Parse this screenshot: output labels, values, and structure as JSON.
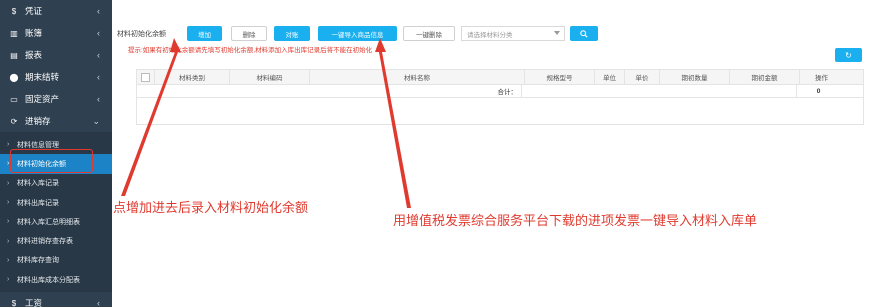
{
  "sidebar": {
    "items": [
      {
        "label": "凭证",
        "icon": "$"
      },
      {
        "label": "账簿",
        "icon": "▥"
      },
      {
        "label": "报表",
        "icon": "▤"
      },
      {
        "label": "期末结转",
        "icon": "⬤"
      },
      {
        "label": "固定资产",
        "icon": "▭"
      },
      {
        "label": "进销存",
        "icon": "⟳"
      }
    ],
    "sub_items": [
      {
        "label": "材料信息管理"
      },
      {
        "label": "材料初始化余额"
      },
      {
        "label": "材料入库记录"
      },
      {
        "label": "材料出库记录"
      },
      {
        "label": "材料入库汇总明细表"
      },
      {
        "label": "材料进销存查存表"
      },
      {
        "label": "材料库存查询"
      },
      {
        "label": "材料出库成本分配表"
      }
    ],
    "bottom_item": {
      "label": "工资",
      "icon": "$"
    }
  },
  "toolbar": {
    "title": "材料初始化余额",
    "add": "增加",
    "delete": "删除",
    "reconcile": "对账",
    "import": "一键导入商品信息",
    "delete_all": "一键删除",
    "category_placeholder": "请选择材料分类"
  },
  "hint": "提示:如果有初始化余额请先填写初始化余额,材料添加入库出库记录后将不能在初始化",
  "table": {
    "headers": [
      "材料类别",
      "材料编码",
      "材料名称",
      "规格型号",
      "单位",
      "单价",
      "期初数量",
      "期初金额",
      "操作"
    ],
    "total_label": "合计：",
    "total_value": "0"
  },
  "annotations": {
    "left": "点增加进去后录入材料初始化余额",
    "right": "用增值税发票综合服务平台下载的进项发票一键导入材料入库单"
  },
  "colors": {
    "sidebar": "#2f4050",
    "accent": "#1ab0f0",
    "annotation": "#e03a2f"
  }
}
